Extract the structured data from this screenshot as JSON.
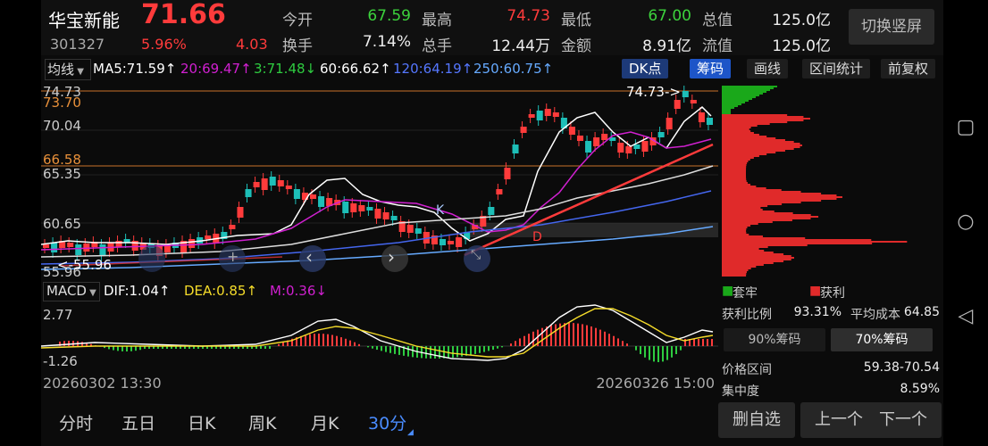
{
  "stock": {
    "name": "华宝新能",
    "price": "71.66",
    "code": "301327",
    "change_pct": "5.96%",
    "change": "4.03"
  },
  "quote": [
    {
      "label": "今开",
      "value": "67.59",
      "color": "#3cd23c"
    },
    {
      "label": "最高",
      "value": "74.73",
      "color": "#ff3b3b"
    },
    {
      "label": "最低",
      "value": "67.00",
      "color": "#3cd23c"
    },
    {
      "label": "总值",
      "value": "125.0亿",
      "color": "#eeeeee"
    },
    {
      "label": "换手",
      "value": "7.14%",
      "color": "#eeeeee"
    },
    {
      "label": "总手",
      "value": "12.44万",
      "color": "#eeeeee"
    },
    {
      "label": "金额",
      "value": "8.91亿",
      "color": "#eeeeee"
    },
    {
      "label": "流值",
      "value": "125.0亿",
      "color": "#eeeeee"
    }
  ],
  "switch_label": "切换竖屏",
  "ma_selector": "均线",
  "ma_items": [
    {
      "text": "MA5:71.59↑",
      "color": "#ffffff"
    },
    {
      "text": "20:69.47↑",
      "color": "#d020d0"
    },
    {
      "text": "3:71.48↓",
      "color": "#2ecc40"
    },
    {
      "text": "60:66.62↑",
      "color": "#ffffff"
    },
    {
      "text": "120:64.19↑",
      "color": "#5577ff"
    },
    {
      "text": "250:60.75↑",
      "color": "#66aaff"
    }
  ],
  "toolbar": {
    "dk": "DK点",
    "chip": "筹码",
    "draw": "画线",
    "range": "区间统计",
    "adjust": "前复权"
  },
  "price_axis": {
    "high": "74.73",
    "l1": "73.70",
    "l2": "70.04",
    "l3": "66.58",
    "l4": "65.35",
    "l5": "60.65",
    "low": "55.96"
  },
  "annotations": {
    "high_marker": "74.73->",
    "low_marker": "<-55.96",
    "k_mark": "K",
    "d_mark": "D"
  },
  "macd": {
    "label": "MACD",
    "dif": "DIF:1.04↑",
    "dea": "DEA:0.85↑",
    "m": "M:0.36↓",
    "top": "2.77",
    "bottom": "-1.26"
  },
  "dates": {
    "start": "20260302 13:30",
    "end": "20260326 15:00"
  },
  "chip_panel": {
    "legend_trap": "套牢",
    "legend_profit": "获利",
    "profit_ratio_label": "获利比例",
    "profit_ratio": "93.31%",
    "avg_cost_label": "平均成本",
    "avg_cost": "64.85",
    "tab90": "90%筹码",
    "tab70": "70%筹码",
    "price_range_label": "价格区间",
    "price_range": "59.38-70.54",
    "concentration_label": "集中度",
    "concentration": "8.59%"
  },
  "periods": [
    "分时",
    "五日",
    "日K",
    "周K",
    "月K",
    "30分"
  ],
  "actions": {
    "delete": "删自选",
    "prev": "上一个",
    "next": "下一个"
  },
  "colors": {
    "up": "#ff3b3b",
    "down": "#3cd23c",
    "chip_red": "#e02a2a",
    "chip_green": "#1aa81a"
  }
}
